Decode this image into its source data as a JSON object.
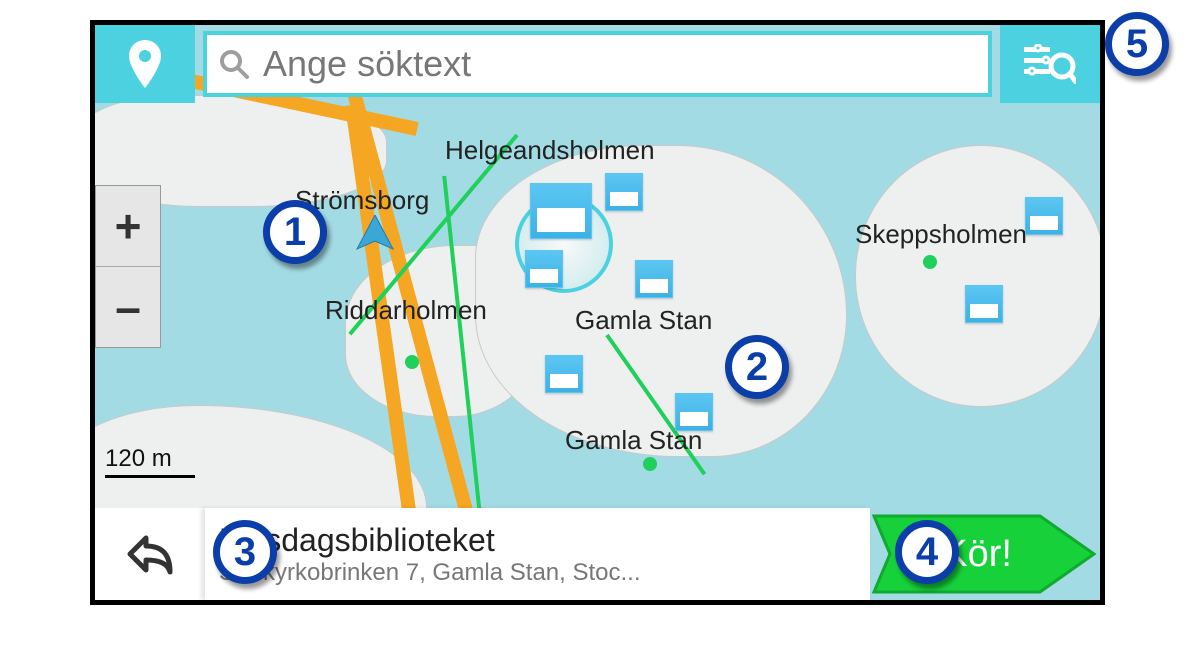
{
  "search": {
    "placeholder": "Ange söktext"
  },
  "zoom": {
    "in": "+",
    "out": "–"
  },
  "scale": {
    "label": "120 m"
  },
  "places": {
    "helgeandsholmen": "Helgeandsholmen",
    "stromsborg": "Strömsborg",
    "riddarholmen": "Riddarholmen",
    "gamla_stan_1": "Gamla Stan",
    "gamla_stan_2": "Gamla Stan",
    "skeppsholmen": "Skeppsholmen"
  },
  "result": {
    "title": "Riksdagsbiblioteket",
    "subtitle": "Storkyrkobrinken 7, Gamla Stan, Stoc..."
  },
  "go": {
    "label": "Kör!"
  },
  "callouts": {
    "1": "1",
    "2": "2",
    "3": "3",
    "4": "4",
    "5": "5"
  }
}
